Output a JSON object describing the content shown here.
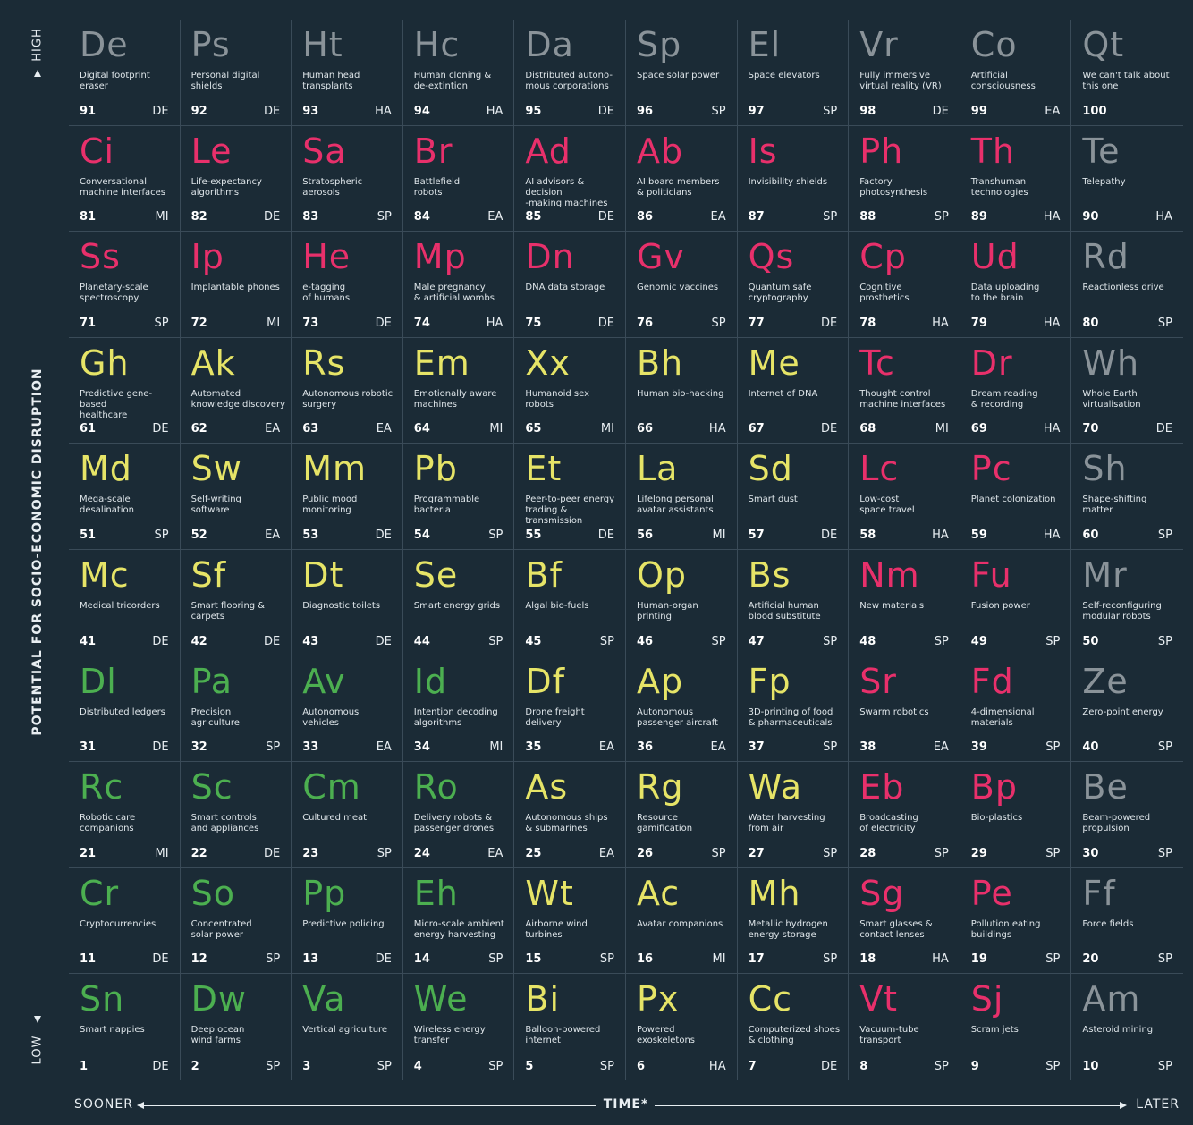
{
  "axes": {
    "y_high": "HIGH",
    "y_low": "LOW",
    "y_title": "POTENTIAL FOR SOCIO-ECONOMIC DISRUPTION",
    "x_sooner": "SOONER",
    "x_later": "LATER",
    "x_title": "TIME*"
  },
  "colors": {
    "grey": "#8a9399",
    "pink": "#e8306b",
    "yellow": "#e6e467",
    "green": "#4caf50"
  },
  "elements": [
    {
      "sym": "De",
      "name": "Digital footprint\neraser",
      "num": "91",
      "cat": "DE",
      "color": "grey"
    },
    {
      "sym": "Ps",
      "name": "Personal digital\nshields",
      "num": "92",
      "cat": "DE",
      "color": "grey"
    },
    {
      "sym": "Ht",
      "name": "Human head\ntransplants",
      "num": "93",
      "cat": "HA",
      "color": "grey"
    },
    {
      "sym": "Hc",
      "name": "Human cloning &\nde-extintion",
      "num": "94",
      "cat": "HA",
      "color": "grey"
    },
    {
      "sym": "Da",
      "name": "Distributed autono-\nmous corporations",
      "num": "95",
      "cat": "DE",
      "color": "grey"
    },
    {
      "sym": "Sp",
      "name": "Space solar power",
      "num": "96",
      "cat": "SP",
      "color": "grey"
    },
    {
      "sym": "El",
      "name": "Space elevators",
      "num": "97",
      "cat": "SP",
      "color": "grey"
    },
    {
      "sym": "Vr",
      "name": "Fully immersive\nvirtual reality (VR)",
      "num": "98",
      "cat": "DE",
      "color": "grey"
    },
    {
      "sym": "Co",
      "name": "Artificial\nconsciousness",
      "num": "99",
      "cat": "EA",
      "color": "grey"
    },
    {
      "sym": "Qt",
      "name": "We can't talk about\nthis one",
      "num": "100",
      "cat": "",
      "color": "grey"
    },
    {
      "sym": "Ci",
      "name": "Conversational\nmachine interfaces",
      "num": "81",
      "cat": "MI",
      "color": "pink"
    },
    {
      "sym": "Le",
      "name": "Life-expectancy\nalgorithms",
      "num": "82",
      "cat": "DE",
      "color": "pink"
    },
    {
      "sym": "Sa",
      "name": "Stratospheric\naerosols",
      "num": "83",
      "cat": "SP",
      "color": "pink"
    },
    {
      "sym": "Br",
      "name": "Battlefield\nrobots",
      "num": "84",
      "cat": "EA",
      "color": "pink"
    },
    {
      "sym": "Ad",
      "name": "AI advisors & decision\n-making machines",
      "num": "85",
      "cat": "DE",
      "color": "pink"
    },
    {
      "sym": "Ab",
      "name": "AI board members\n& politicians",
      "num": "86",
      "cat": "EA",
      "color": "pink"
    },
    {
      "sym": "Is",
      "name": "Invisibility shields",
      "num": "87",
      "cat": "SP",
      "color": "pink"
    },
    {
      "sym": "Ph",
      "name": "Factory\nphotosynthesis",
      "num": "88",
      "cat": "SP",
      "color": "pink"
    },
    {
      "sym": "Th",
      "name": "Transhuman\ntechnologies",
      "num": "89",
      "cat": "HA",
      "color": "pink"
    },
    {
      "sym": "Te",
      "name": "Telepathy",
      "num": "90",
      "cat": "HA",
      "color": "grey"
    },
    {
      "sym": "Ss",
      "name": "Planetary-scale\nspectroscopy",
      "num": "71",
      "cat": "SP",
      "color": "pink"
    },
    {
      "sym": "Ip",
      "name": "Implantable phones",
      "num": "72",
      "cat": "MI",
      "color": "pink"
    },
    {
      "sym": "He",
      "name": "e-tagging\nof humans",
      "num": "73",
      "cat": "DE",
      "color": "pink"
    },
    {
      "sym": "Mp",
      "name": "Male pregnancy\n& artificial wombs",
      "num": "74",
      "cat": "HA",
      "color": "pink"
    },
    {
      "sym": "Dn",
      "name": "DNA data storage",
      "num": "75",
      "cat": "DE",
      "color": "pink"
    },
    {
      "sym": "Gv",
      "name": "Genomic vaccines",
      "num": "76",
      "cat": "SP",
      "color": "pink"
    },
    {
      "sym": "Qs",
      "name": "Quantum safe\ncryptography",
      "num": "77",
      "cat": "DE",
      "color": "pink"
    },
    {
      "sym": "Cp",
      "name": "Cognitive\nprosthetics",
      "num": "78",
      "cat": "HA",
      "color": "pink"
    },
    {
      "sym": "Ud",
      "name": "Data uploading\nto the brain",
      "num": "79",
      "cat": "HA",
      "color": "pink"
    },
    {
      "sym": "Rd",
      "name": "Reactionless drive",
      "num": "80",
      "cat": "SP",
      "color": "grey"
    },
    {
      "sym": "Gh",
      "name": "Predictive gene-based\nhealthcare",
      "num": "61",
      "cat": "DE",
      "color": "yellow"
    },
    {
      "sym": "Ak",
      "name": "Automated\nknowledge discovery",
      "num": "62",
      "cat": "EA",
      "color": "yellow"
    },
    {
      "sym": "Rs",
      "name": "Autonomous robotic\nsurgery",
      "num": "63",
      "cat": "EA",
      "color": "yellow"
    },
    {
      "sym": "Em",
      "name": "Emotionally aware\nmachines",
      "num": "64",
      "cat": "MI",
      "color": "yellow"
    },
    {
      "sym": "Xx",
      "name": "Humanoid sex\nrobots",
      "num": "65",
      "cat": "MI",
      "color": "yellow"
    },
    {
      "sym": "Bh",
      "name": "Human bio-hacking",
      "num": "66",
      "cat": "HA",
      "color": "yellow"
    },
    {
      "sym": "Me",
      "name": "Internet of DNA",
      "num": "67",
      "cat": "DE",
      "color": "yellow"
    },
    {
      "sym": "Tc",
      "name": "Thought control\nmachine interfaces",
      "num": "68",
      "cat": "MI",
      "color": "pink"
    },
    {
      "sym": "Dr",
      "name": "Dream reading\n& recording",
      "num": "69",
      "cat": "HA",
      "color": "pink"
    },
    {
      "sym": "Wh",
      "name": "Whole Earth\nvirtualisation",
      "num": "70",
      "cat": "DE",
      "color": "grey"
    },
    {
      "sym": "Md",
      "name": "Mega-scale\ndesalination",
      "num": "51",
      "cat": "SP",
      "color": "yellow"
    },
    {
      "sym": "Sw",
      "name": "Self-writing\nsoftware",
      "num": "52",
      "cat": "EA",
      "color": "yellow"
    },
    {
      "sym": "Mm",
      "name": "Public mood\nmonitoring",
      "num": "53",
      "cat": "DE",
      "color": "yellow"
    },
    {
      "sym": "Pb",
      "name": "Programmable\nbacteria",
      "num": "54",
      "cat": "SP",
      "color": "yellow"
    },
    {
      "sym": "Et",
      "name": "Peer-to-peer energy\ntrading & transmission",
      "num": "55",
      "cat": "DE",
      "color": "yellow"
    },
    {
      "sym": "La",
      "name": "Lifelong personal\navatar assistants",
      "num": "56",
      "cat": "MI",
      "color": "yellow"
    },
    {
      "sym": "Sd",
      "name": "Smart dust",
      "num": "57",
      "cat": "DE",
      "color": "yellow"
    },
    {
      "sym": "Lc",
      "name": "Low-cost\nspace travel",
      "num": "58",
      "cat": "HA",
      "color": "pink"
    },
    {
      "sym": "Pc",
      "name": "Planet colonization",
      "num": "59",
      "cat": "HA",
      "color": "pink"
    },
    {
      "sym": "Sh",
      "name": "Shape-shifting\nmatter",
      "num": "60",
      "cat": "SP",
      "color": "grey"
    },
    {
      "sym": "Mc",
      "name": "Medical tricorders",
      "num": "41",
      "cat": "DE",
      "color": "yellow"
    },
    {
      "sym": "Sf",
      "name": "Smart flooring &\ncarpets",
      "num": "42",
      "cat": "DE",
      "color": "yellow"
    },
    {
      "sym": "Dt",
      "name": "Diagnostic toilets",
      "num": "43",
      "cat": "DE",
      "color": "yellow"
    },
    {
      "sym": "Se",
      "name": "Smart energy grids",
      "num": "44",
      "cat": "SP",
      "color": "yellow"
    },
    {
      "sym": "Bf",
      "name": "Algal bio-fuels",
      "num": "45",
      "cat": "SP",
      "color": "yellow"
    },
    {
      "sym": "Op",
      "name": "Human-organ\nprinting",
      "num": "46",
      "cat": "SP",
      "color": "yellow"
    },
    {
      "sym": "Bs",
      "name": "Artificial human\nblood substitute",
      "num": "47",
      "cat": "SP",
      "color": "yellow"
    },
    {
      "sym": "Nm",
      "name": "New materials",
      "num": "48",
      "cat": "SP",
      "color": "pink"
    },
    {
      "sym": "Fu",
      "name": "Fusion power",
      "num": "49",
      "cat": "SP",
      "color": "pink"
    },
    {
      "sym": "Mr",
      "name": "Self-reconfiguring\nmodular robots",
      "num": "50",
      "cat": "SP",
      "color": "grey"
    },
    {
      "sym": "Dl",
      "name": "Distributed ledgers",
      "num": "31",
      "cat": "DE",
      "color": "green"
    },
    {
      "sym": "Pa",
      "name": "Precision\nagriculture",
      "num": "32",
      "cat": "SP",
      "color": "green"
    },
    {
      "sym": "Av",
      "name": "Autonomous\nvehicles",
      "num": "33",
      "cat": "EA",
      "color": "green"
    },
    {
      "sym": "Id",
      "name": "Intention decoding\nalgorithms",
      "num": "34",
      "cat": "MI",
      "color": "green"
    },
    {
      "sym": "Df",
      "name": "Drone freight\ndelivery",
      "num": "35",
      "cat": "EA",
      "color": "yellow"
    },
    {
      "sym": "Ap",
      "name": "Autonomous\npassenger aircraft",
      "num": "36",
      "cat": "EA",
      "color": "yellow"
    },
    {
      "sym": "Fp",
      "name": "3D-printing of food\n& pharmaceuticals",
      "num": "37",
      "cat": "SP",
      "color": "yellow"
    },
    {
      "sym": "Sr",
      "name": "Swarm robotics",
      "num": "38",
      "cat": "EA",
      "color": "pink"
    },
    {
      "sym": "Fd",
      "name": "4-dimensional\nmaterials",
      "num": "39",
      "cat": "SP",
      "color": "pink"
    },
    {
      "sym": "Ze",
      "name": "Zero-point energy",
      "num": "40",
      "cat": "SP",
      "color": "grey"
    },
    {
      "sym": "Rc",
      "name": "Robotic care\ncompanions",
      "num": "21",
      "cat": "MI",
      "color": "green"
    },
    {
      "sym": "Sc",
      "name": "Smart controls\nand appliances",
      "num": "22",
      "cat": "DE",
      "color": "green"
    },
    {
      "sym": "Cm",
      "name": "Cultured meat",
      "num": "23",
      "cat": "SP",
      "color": "green"
    },
    {
      "sym": "Ro",
      "name": "Delivery robots &\npassenger drones",
      "num": "24",
      "cat": "EA",
      "color": "green"
    },
    {
      "sym": "As",
      "name": "Autonomous ships\n& submarines",
      "num": "25",
      "cat": "EA",
      "color": "yellow"
    },
    {
      "sym": "Rg",
      "name": "Resource\ngamification",
      "num": "26",
      "cat": "SP",
      "color": "yellow"
    },
    {
      "sym": "Wa",
      "name": "Water harvesting\nfrom air",
      "num": "27",
      "cat": "SP",
      "color": "yellow"
    },
    {
      "sym": "Eb",
      "name": "Broadcasting\nof electricity",
      "num": "28",
      "cat": "SP",
      "color": "pink"
    },
    {
      "sym": "Bp",
      "name": "Bio-plastics",
      "num": "29",
      "cat": "SP",
      "color": "pink"
    },
    {
      "sym": "Be",
      "name": "Beam-powered\npropulsion",
      "num": "30",
      "cat": "SP",
      "color": "grey"
    },
    {
      "sym": "Cr",
      "name": "Cryptocurrencies",
      "num": "11",
      "cat": "DE",
      "color": "green"
    },
    {
      "sym": "So",
      "name": "Concentrated\nsolar power",
      "num": "12",
      "cat": "SP",
      "color": "green"
    },
    {
      "sym": "Pp",
      "name": "Predictive policing",
      "num": "13",
      "cat": "DE",
      "color": "green"
    },
    {
      "sym": "Eh",
      "name": "Micro-scale ambient\nenergy harvesting",
      "num": "14",
      "cat": "SP",
      "color": "green"
    },
    {
      "sym": "Wt",
      "name": "Airborne wind\nturbines",
      "num": "15",
      "cat": "SP",
      "color": "yellow"
    },
    {
      "sym": "Ac",
      "name": "Avatar companions",
      "num": "16",
      "cat": "MI",
      "color": "yellow"
    },
    {
      "sym": "Mh",
      "name": "Metallic hydrogen\nenergy storage",
      "num": "17",
      "cat": "SP",
      "color": "yellow"
    },
    {
      "sym": "Sg",
      "name": "Smart glasses &\ncontact lenses",
      "num": "18",
      "cat": "HA",
      "color": "pink"
    },
    {
      "sym": "Pe",
      "name": "Pollution eating\nbuildings",
      "num": "19",
      "cat": "SP",
      "color": "pink"
    },
    {
      "sym": "Ff",
      "name": "Force fields",
      "num": "20",
      "cat": "SP",
      "color": "grey"
    },
    {
      "sym": "Sn",
      "name": "Smart nappies",
      "num": "1",
      "cat": "DE",
      "color": "green"
    },
    {
      "sym": "Dw",
      "name": "Deep ocean\nwind farms",
      "num": "2",
      "cat": "SP",
      "color": "green"
    },
    {
      "sym": "Va",
      "name": "Vertical agriculture",
      "num": "3",
      "cat": "SP",
      "color": "green"
    },
    {
      "sym": "We",
      "name": "Wireless energy\ntransfer",
      "num": "4",
      "cat": "SP",
      "color": "green"
    },
    {
      "sym": "Bi",
      "name": "Balloon-powered\ninternet",
      "num": "5",
      "cat": "SP",
      "color": "yellow"
    },
    {
      "sym": "Px",
      "name": "Powered\nexoskeletons",
      "num": "6",
      "cat": "HA",
      "color": "yellow"
    },
    {
      "sym": "Cc",
      "name": "Computerized shoes\n& clothing",
      "num": "7",
      "cat": "DE",
      "color": "yellow"
    },
    {
      "sym": "Vt",
      "name": "Vacuum-tube\ntransport",
      "num": "8",
      "cat": "SP",
      "color": "pink"
    },
    {
      "sym": "Sj",
      "name": "Scram jets",
      "num": "9",
      "cat": "SP",
      "color": "pink"
    },
    {
      "sym": "Am",
      "name": "Asteroid mining",
      "num": "10",
      "cat": "SP",
      "color": "grey"
    }
  ]
}
